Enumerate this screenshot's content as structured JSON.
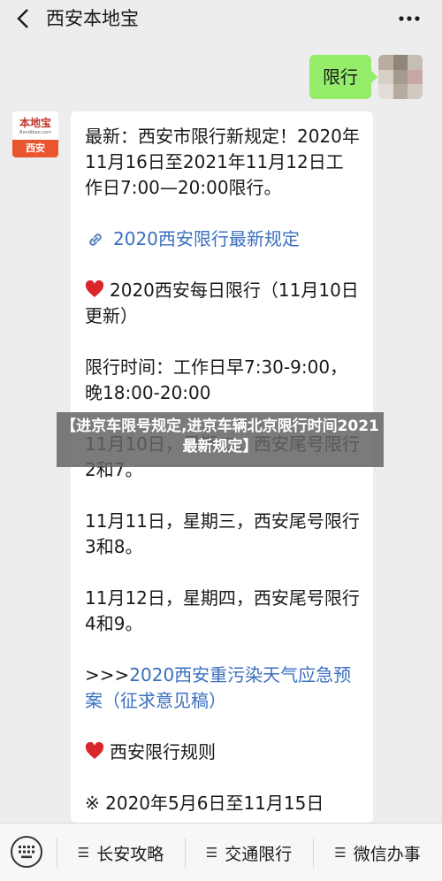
{
  "header": {
    "title": "西安本地宝"
  },
  "user_message": {
    "text": "限行"
  },
  "bot": {
    "avatar_logo": "本地宝",
    "avatar_sub": "Bendibao.com",
    "avatar_city": "西安",
    "message": {
      "intro": "最新：西安市限行新规定！2020年11月16日至2021年11月12日工作日7:00—20:00限行。",
      "link1": "2020西安限行最新规定",
      "daily": "2020西安每日限行（11月10日更新）",
      "time": "限行时间：工作日早7:30-9:00，晚18:00-20:00",
      "d1": "11月10日，星期二，西安尾号限行2和7。",
      "d2": "11月11日，星期三，西安尾号限行3和8。",
      "d3": "11月12日，星期四，西安尾号限行4和9。",
      "prefix": ">>>",
      "link2": "2020西安重污染天气应急预案（征求意见稿）",
      "rules": "西安限行规则",
      "period": "※ 2020年5月6日至11月15日"
    }
  },
  "overlay": {
    "text": "【进京车限号规定,进京车辆北京限行时间2021最新规定】"
  },
  "menu": {
    "items": [
      {
        "label": "长安攻略"
      },
      {
        "label": "交通限行"
      },
      {
        "label": "微信办事"
      }
    ]
  },
  "colors": {
    "bubble_green": "#95ec69",
    "link_blue": "#3b6fbf",
    "heart_red": "#d9262b"
  }
}
